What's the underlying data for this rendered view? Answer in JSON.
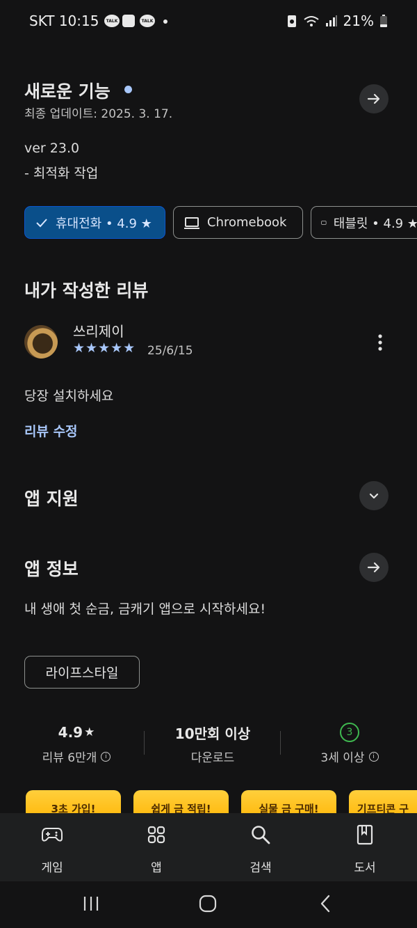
{
  "status_bar": {
    "time": "SKT 10:15",
    "notifications": [
      "talk-icon",
      "flipboard-icon",
      "talk-icon",
      "dot"
    ],
    "battery": "21%"
  },
  "whats_new": {
    "title": "새로운 기능",
    "updated": "최종 업데이트: 2025. 3. 17.",
    "version": "ver 23.0",
    "note": "- 최적화 작업"
  },
  "device_chips": [
    {
      "label": "휴대전화 • 4.9 ★",
      "icon": "check-icon",
      "selected": true
    },
    {
      "label": "Chromebook",
      "icon": "laptop-icon",
      "selected": false
    },
    {
      "label": "태블릿 • 4.9 ★",
      "icon": "tablet-icon",
      "selected": false
    }
  ],
  "my_review": {
    "heading": "내가 작성한 리뷰",
    "author": "쓰리제이",
    "stars": "★★★★★",
    "rating": 5,
    "date": "25/6/15",
    "text": "당장 설치하세요",
    "edit_link": "리뷰 수정"
  },
  "app_support": {
    "heading": "앱 지원"
  },
  "app_info": {
    "heading": "앱 정보",
    "description": "내 생애 첫 순금, 금캐기 앱으로 시작하세요!",
    "category": "라이프스타일"
  },
  "stats": {
    "rating_value": "4.9",
    "rating_star": "★",
    "rating_label": "리뷰 6만개",
    "downloads_value": "10만회 이상",
    "downloads_label": "다운로드",
    "age_badge": "3",
    "age_label": "3세 이상"
  },
  "screenshots": [
    "3초 가입!",
    "쉽게 금 적립!",
    "실물 금 구매!",
    "기프티콘 구"
  ],
  "bottom_nav": {
    "games": "게임",
    "apps": "앱",
    "search": "검색",
    "books": "도서"
  },
  "colors": {
    "background": "#131314",
    "accent_blue": "#a8c7fa",
    "selected_chip": "#0a4f8a",
    "age_green": "#3fb950"
  }
}
